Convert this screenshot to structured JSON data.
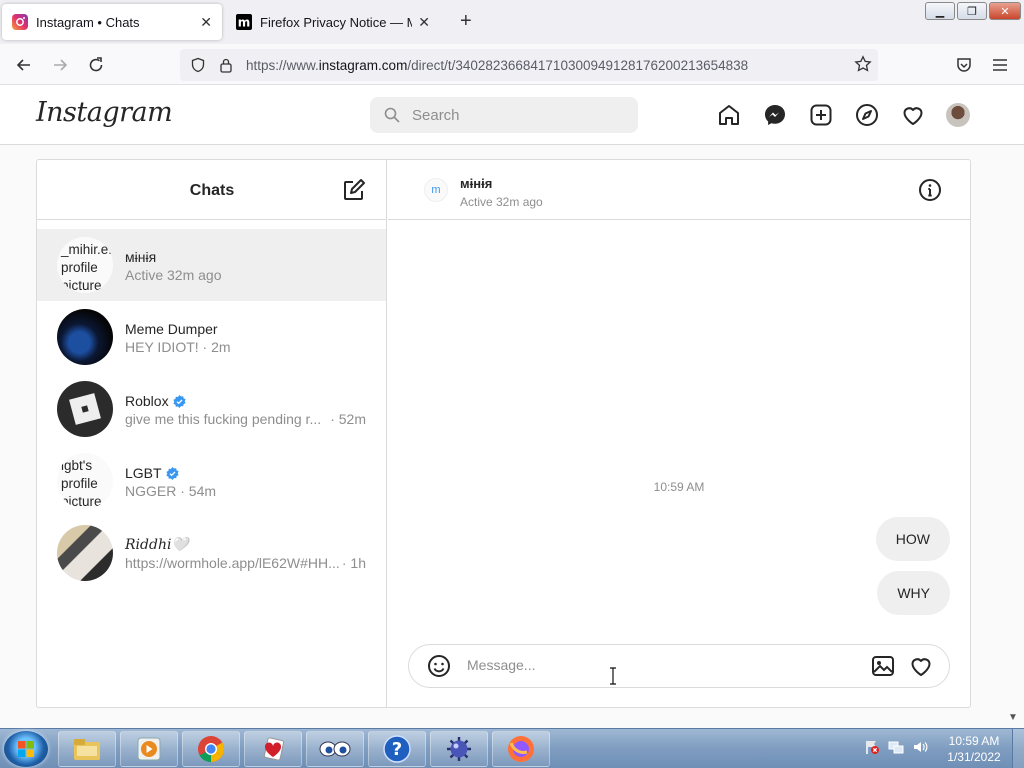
{
  "browser": {
    "tabs": [
      {
        "title": "Instagram • Chats",
        "active": true
      },
      {
        "title": "Firefox Privacy Notice — Mozilla",
        "active": false
      }
    ],
    "url_prefix": "https://www.",
    "url_domain": "instagram.com",
    "url_path": "/direct/t/340282366841710300949128176200213654838"
  },
  "instagram": {
    "logo": "Instagram",
    "search_placeholder": "Search"
  },
  "chats": {
    "title": "Chats",
    "threads": [
      {
        "name": "мɨнɨя",
        "sub": "Active 32m ago",
        "time": "",
        "avatar_alt": "_mihir.e: profile picture",
        "selected": true
      },
      {
        "name": "Meme Dumper",
        "sub": "HEY IDIOT! · 2m",
        "time": "",
        "avatar_alt": "",
        "selected": false
      },
      {
        "name": "Roblox",
        "sub": "give me this fucking pending r...",
        "time": "· 52m",
        "avatar_alt": "",
        "verified": true
      },
      {
        "name": "LGBT",
        "sub": "NGGER · 54m",
        "time": "",
        "avatar_alt": "lgbt's profile picture",
        "verified": true
      },
      {
        "name": "𝑅𝑖𝑑𝑑ℎ𝑖🤍",
        "sub": "https://wormhole.app/lE62W#HH...",
        "time": "· 1h",
        "avatar_alt": ""
      }
    ]
  },
  "conversation": {
    "name": "мɨнɨя",
    "status": "Active 32m ago",
    "avatar_letter": "m",
    "timestamp": "10:59 AM",
    "messages": [
      "HOW",
      "WHY"
    ],
    "input_placeholder": "Message..."
  },
  "taskbar": {
    "time": "10:59 AM",
    "date": "1/31/2022"
  },
  "colors": {
    "verified": "#3897f0",
    "selected_row": "#efefef",
    "bubble": "#efefef"
  }
}
